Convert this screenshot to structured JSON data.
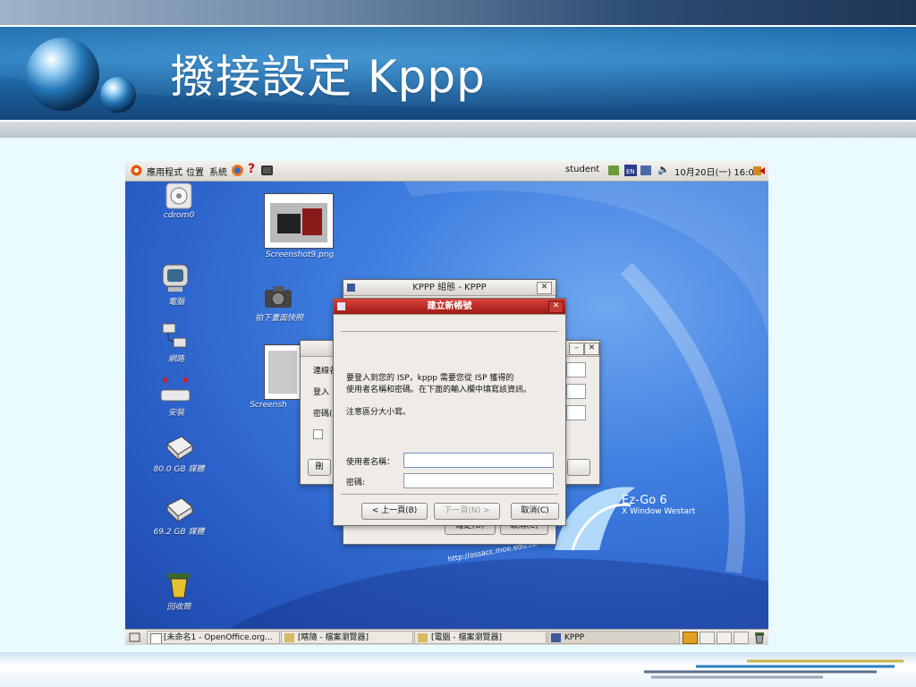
{
  "slide": {
    "title": "撥接設定 Kppp"
  },
  "panel": {
    "menus": [
      "應用程式",
      "位置",
      "系統"
    ],
    "user": "student",
    "clock": "10月20日(一) 16:06"
  },
  "desktop_icons": [
    {
      "label": "cdrom0",
      "icon": "cdrom-icon"
    },
    {
      "label": "Screenshot9.png",
      "icon": "image-file-icon"
    },
    {
      "label": "電腦",
      "icon": "computer-icon"
    },
    {
      "label": "拍下畫面快照",
      "icon": "camera-icon"
    },
    {
      "label": "網路",
      "icon": "network-icon"
    },
    {
      "label": "Screensh",
      "icon": "image-file-icon"
    },
    {
      "label": "安裝",
      "icon": "install-icon"
    },
    {
      "label": "80.0 GB 媒體",
      "icon": "harddisk-icon"
    },
    {
      "label": "69.2 GB 媒體",
      "icon": "harddisk-icon"
    },
    {
      "label": "回收筒",
      "icon": "trash-icon"
    }
  ],
  "wallpaper": {
    "brand": "Ez-Go 6",
    "tagline": "X Window Westart",
    "url": "http://ossacc.moe.edu.tw"
  },
  "kppp_config": {
    "title": "KPPP 組態 - KPPP",
    "ok": "確定(O)",
    "cancel": "取消(C)"
  },
  "bg_dialog": {
    "labels": [
      "連線名",
      "登入",
      "密碼("
    ],
    "button": "刪"
  },
  "new_account": {
    "title": "建立新帳號",
    "intro_line1": "要登入到您的 ISP，kppp 需要您從 ISP 獲得的",
    "intro_line2": "使用者名稱和密碼。在下面的輸入欄中填寫該資訊。",
    "note": "注意區分大小寫。",
    "username_label": "使用者名稱：",
    "username_value": "",
    "password_label": "密碼:",
    "password_value": "",
    "back": "< 上一頁(B)",
    "next": "下一頁(N) >",
    "cancel": "取消(C)"
  },
  "taskbar": [
    "[未命名1 - OpenOffice.org...",
    "[瞎隨 - 檔案瀏覽器]",
    "[電腦 - 檔案瀏覽器]",
    "KPPP"
  ],
  "colors": {
    "title_band": "#1d6aa8",
    "dialog_titlebar_active": "#b52620",
    "desktop_blue": "#3f7fe0"
  }
}
